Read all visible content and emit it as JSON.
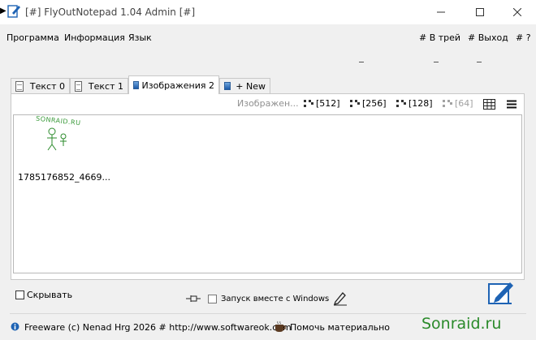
{
  "window": {
    "title": "[#] FlyOutNotepad 1.04 Admin [#]",
    "controls": [
      "minimize",
      "maximize",
      "close"
    ]
  },
  "menu": {
    "items": [
      "Программа",
      "Информация",
      "Язык"
    ],
    "right_items": [
      "# В трей",
      "# Выход",
      "# ?"
    ]
  },
  "tabs": [
    {
      "label": "Текст 0",
      "icon": "document-icon",
      "active": false
    },
    {
      "label": "Текст 1",
      "icon": "document-icon",
      "active": false
    },
    {
      "label": "Изображения 2",
      "icon": "image-icon",
      "active": true
    },
    {
      "label": "+ New",
      "icon": "image-icon",
      "active": false
    }
  ],
  "toolbar": {
    "hint": "Изображен...",
    "sizes": [
      "[512]",
      "[256]",
      "[128]",
      "[64]"
    ],
    "grid_icon": "grid-icon",
    "menu_icon": "hamburger-icon"
  },
  "content": {
    "thumb_watermark": "SONRAID.RU",
    "filename": "1785176852_4669..."
  },
  "bottom": {
    "hide_label": "Скрывать",
    "autostart_label": "Запуск вместе с Windows"
  },
  "footer": {
    "copyright": "Freeware (c) Nenad Hrg 2026 # http://www.softwareok.com",
    "donate": "Помочь материально",
    "watermark": "Sonraid.ru"
  },
  "colors": {
    "accent_blue": "#1e63b4",
    "watermark_green": "#2a8a2a"
  }
}
